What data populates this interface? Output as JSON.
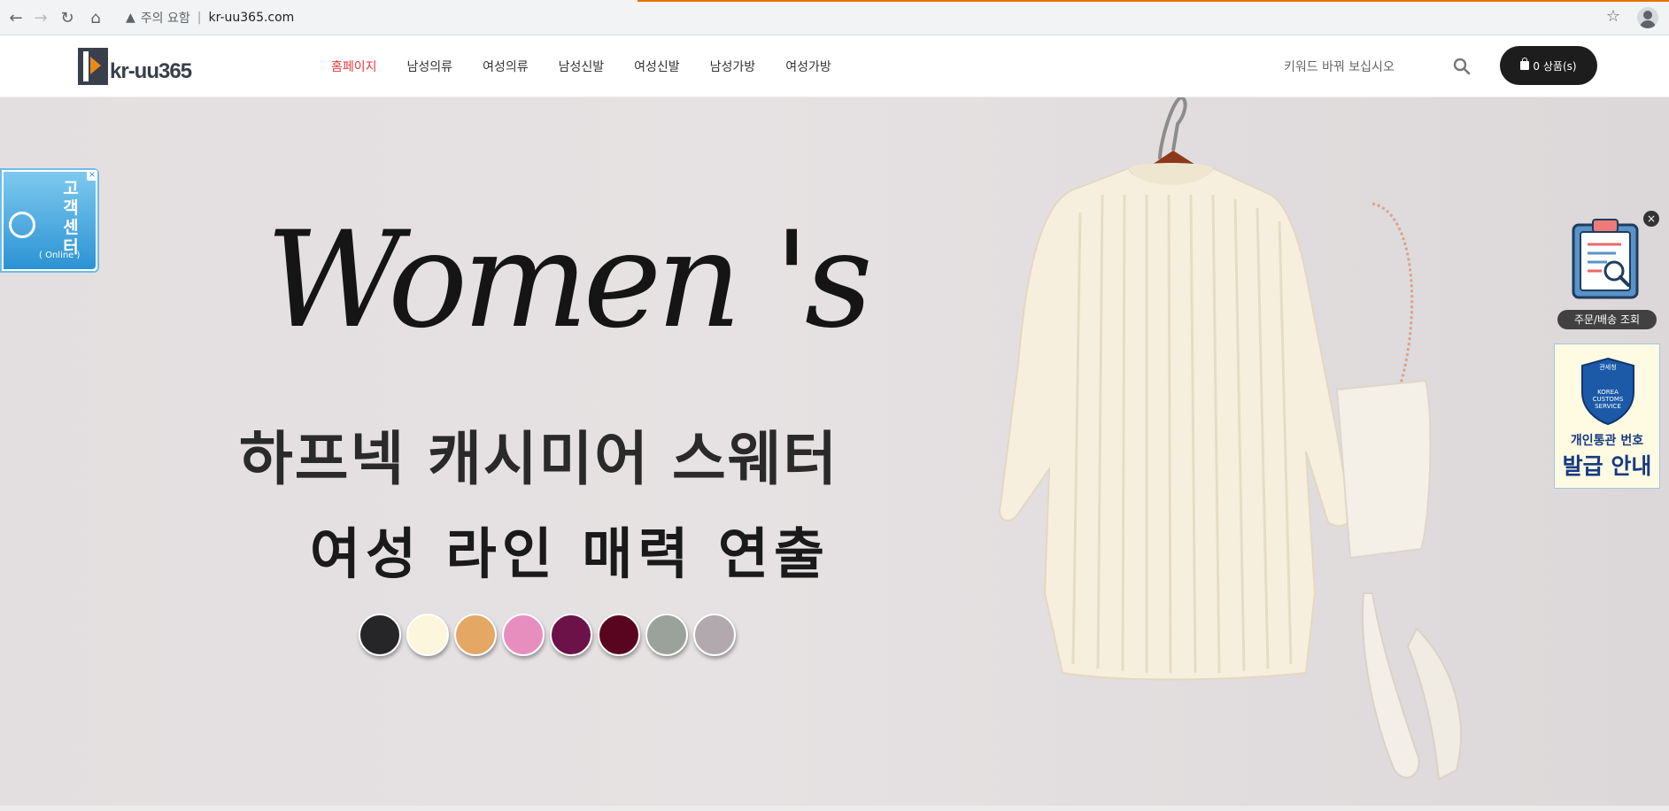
{
  "browser": {
    "back_icon": "←",
    "forward_icon": "→",
    "reload_icon": "↻",
    "home_icon": "⌂",
    "warning_text": "주의 요함",
    "url": "kr-uu365.com",
    "star_icon": "☆"
  },
  "header": {
    "logo_text": "kr-uu365",
    "nav": [
      {
        "label": "홈페이지",
        "active": true
      },
      {
        "label": "남성의류"
      },
      {
        "label": "여성의류"
      },
      {
        "label": "남성신발"
      },
      {
        "label": "여성신발"
      },
      {
        "label": "남성가방"
      },
      {
        "label": "여성가방"
      }
    ],
    "search_placeholder": "키워드 바꿔 보십시오",
    "cart_label": "0 상품(s)"
  },
  "hero": {
    "title": "Women 's",
    "subtitle1": "하프넥 캐시미어 스웨터",
    "subtitle2": "여성 라인 매력 연출",
    "swatches": [
      "#262628",
      "#fbf6dc",
      "#e4a764",
      "#e88ebe",
      "#6d1248",
      "#5a0520",
      "#9aa29b",
      "#b1a9ad"
    ]
  },
  "cs_widget": {
    "label_chars": [
      "고",
      "객",
      "센",
      "터"
    ],
    "online_text": "( Online )",
    "close_icon": "×"
  },
  "order_widget": {
    "label": "주문/배송 조회",
    "close_icon": "×"
  },
  "customs_widget": {
    "seal_top": "관세청",
    "seal_text": [
      "KOREA",
      "CUSTOMS",
      "SERVICE"
    ],
    "line1": "개인통관 번호",
    "line2": "발급 안내"
  }
}
